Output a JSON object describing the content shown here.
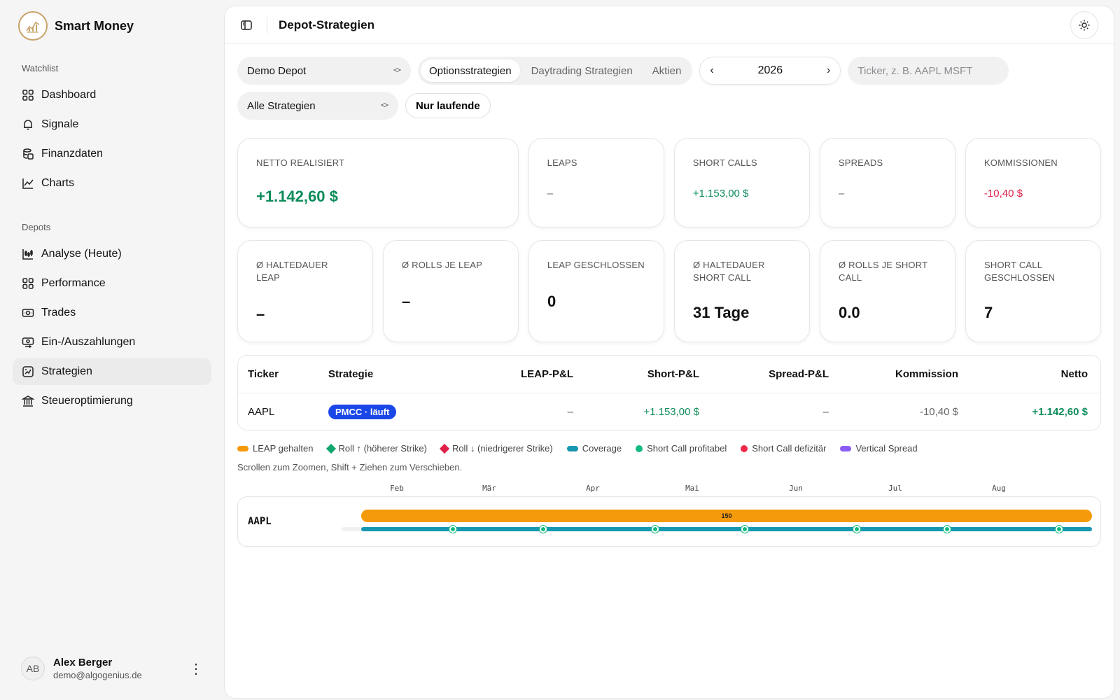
{
  "app": {
    "name": "Smart Money"
  },
  "sidebar": {
    "watchlist_label": "Watchlist",
    "watchlist_items": [
      {
        "label": "Dashboard",
        "icon": "grid-icon"
      },
      {
        "label": "Signale",
        "icon": "bell-icon"
      },
      {
        "label": "Finanzdaten",
        "icon": "coins-icon"
      },
      {
        "label": "Charts",
        "icon": "line-chart-icon"
      }
    ],
    "depots_label": "Depots",
    "depot_items": [
      {
        "label": "Analyse (Heute)",
        "icon": "candlestick-icon"
      },
      {
        "label": "Performance",
        "icon": "grid-icon"
      },
      {
        "label": "Trades",
        "icon": "money-icon"
      },
      {
        "label": "Ein-/Auszahlungen",
        "icon": "money-transfer-icon"
      },
      {
        "label": "Strategien",
        "icon": "strategy-icon",
        "active": true
      },
      {
        "label": "Steueroptimierung",
        "icon": "bank-icon"
      }
    ],
    "user": {
      "initials": "AB",
      "name": "Alex Berger",
      "email": "demo@algogenius.de"
    }
  },
  "header": {
    "title": "Depot-Strategien"
  },
  "filters": {
    "depot": "Demo Depot",
    "tabs": [
      "Optionsstrategien",
      "Daytrading Strategien",
      "Aktien"
    ],
    "active_tab": 0,
    "year": "2026",
    "search_placeholder": "Ticker, z. B. AAPL MSFT",
    "strategy": "Alle Strategien",
    "running_only_label": "Nur laufende"
  },
  "stats_row1": [
    {
      "label": "Netto realisiert",
      "value": "+1.142,60 $",
      "tone": "pos"
    },
    {
      "label": "LEAPs",
      "value": "–",
      "tone": "muted"
    },
    {
      "label": "Short Calls",
      "value": "+1.153,00 $",
      "tone": "pos"
    },
    {
      "label": "Spreads",
      "value": "–",
      "tone": "muted"
    },
    {
      "label": "Kommissionen",
      "value": "-10,40 $",
      "tone": "neg"
    }
  ],
  "stats_row2": [
    {
      "label": "Ø Haltedauer LEAP",
      "value": "–"
    },
    {
      "label": "Ø Rolls je LEAP",
      "value": "–"
    },
    {
      "label": "LEAP geschlossen",
      "value": "0"
    },
    {
      "label": "Ø Haltedauer Short Call",
      "value": "31 Tage"
    },
    {
      "label": "Ø Rolls je Short Call",
      "value": "0.0"
    },
    {
      "label": "Short Call geschlossen",
      "value": "7"
    }
  ],
  "table": {
    "columns": [
      "Ticker",
      "Strategie",
      "LEAP-P&L",
      "Short-P&L",
      "Spread-P&L",
      "Kommission",
      "Netto"
    ],
    "rows": [
      {
        "ticker": "AAPL",
        "strategy": "PMCC · läuft",
        "leap": "–",
        "short": "+1.153,00 $",
        "spread": "–",
        "commission": "-10,40 $",
        "net": "+1.142,60 $"
      }
    ]
  },
  "legend": [
    {
      "label": "LEAP gehalten",
      "shape": "pill",
      "color": "#f59a0a"
    },
    {
      "label": "Roll ↑ (höherer Strike)",
      "shape": "diamond",
      "color": "#12a56f"
    },
    {
      "label": "Roll ↓ (niedrigerer Strike)",
      "shape": "diamond",
      "color": "#e0204a"
    },
    {
      "label": "Coverage",
      "shape": "pill",
      "color": "#1797b0"
    },
    {
      "label": "Short Call profitabel",
      "shape": "dot",
      "color": "#12b981"
    },
    {
      "label": "Short Call defizitär",
      "shape": "dot",
      "color": "#f0284a"
    },
    {
      "label": "Vertical Spread",
      "shape": "pill",
      "color": "#8b5cf6"
    }
  ],
  "hint": "Scrollen zum Zoomen, Shift + Ziehen zum Verschieben.",
  "timeline": {
    "months": [
      "Feb",
      "Mär",
      "Apr",
      "Mai",
      "Jun",
      "Jul",
      "Aug"
    ],
    "ticker": "AAPL",
    "leap_label": "150",
    "short_call_count": 7
  }
}
